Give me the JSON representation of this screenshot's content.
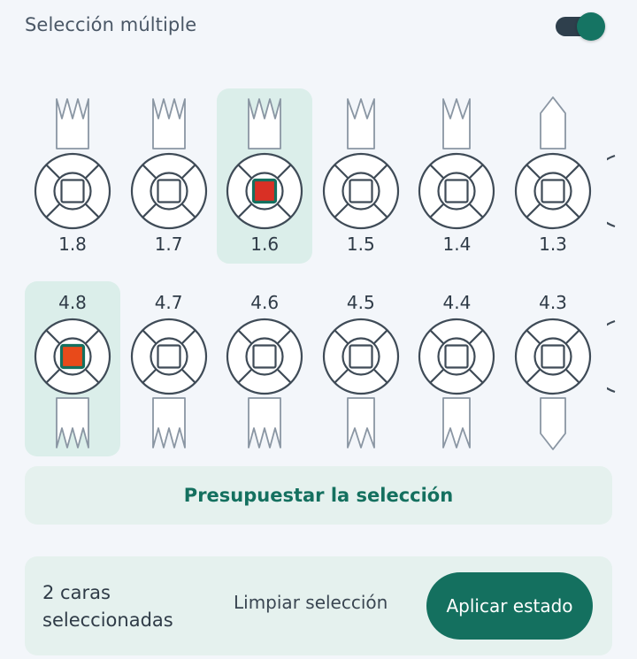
{
  "header": {
    "title": "Selección múltiple",
    "toggle_on": true
  },
  "colors": {
    "accent": "#14705f",
    "selected_bg": "#dbeeea",
    "marked_red": "#d93025",
    "marked_orange": "#e84a1a",
    "outline": "#3f4b57",
    "root": "#8a96a3"
  },
  "upper_row": [
    {
      "number": "1.8",
      "root": "triple",
      "selected": false,
      "marked": false
    },
    {
      "number": "1.7",
      "root": "triple",
      "selected": false,
      "marked": false
    },
    {
      "number": "1.6",
      "root": "triple",
      "selected": true,
      "marked": true,
      "mark_color": "#d93025"
    },
    {
      "number": "1.5",
      "root": "double",
      "selected": false,
      "marked": false
    },
    {
      "number": "1.4",
      "root": "double",
      "selected": false,
      "marked": false
    },
    {
      "number": "1.3",
      "root": "single",
      "selected": false,
      "marked": false
    }
  ],
  "lower_row": [
    {
      "number": "4.8",
      "root": "triple",
      "selected": true,
      "marked": true,
      "mark_color": "#e84a1a"
    },
    {
      "number": "4.7",
      "root": "triple",
      "selected": false,
      "marked": false
    },
    {
      "number": "4.6",
      "root": "triple",
      "selected": false,
      "marked": false
    },
    {
      "number": "4.5",
      "root": "double",
      "selected": false,
      "marked": false
    },
    {
      "number": "4.4",
      "root": "double",
      "selected": false,
      "marked": false
    },
    {
      "number": "4.3",
      "root": "single",
      "selected": false,
      "marked": false
    }
  ],
  "budget": {
    "label": "Presupuestar la selección"
  },
  "footer": {
    "count_text": "2 caras seleccionadas",
    "clear_label": "Limpiar selección",
    "apply_label": "Aplicar estado"
  }
}
